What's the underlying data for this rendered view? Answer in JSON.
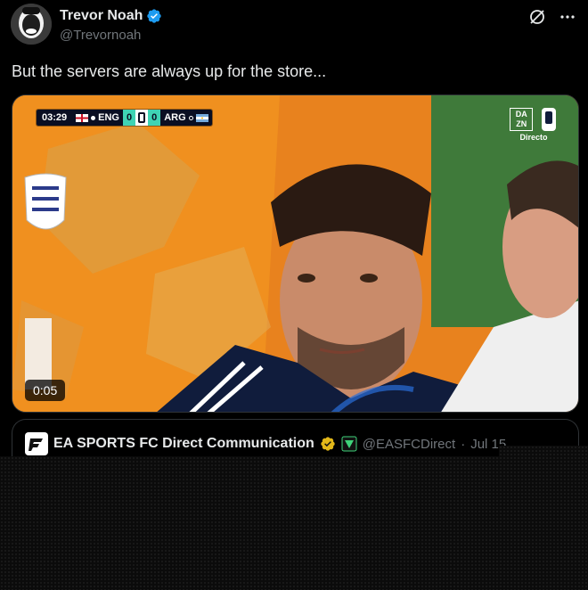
{
  "tweet": {
    "author": {
      "display_name": "Trevor Noah",
      "handle": "@Trevornoah",
      "verified_badge_color": "#1d9bf0"
    },
    "text": "But the servers are always up for the store...",
    "icons": {
      "grok": "grok-icon",
      "more": "more-icon"
    }
  },
  "video": {
    "duration": "0:05",
    "scorebug": {
      "clock": "03:29",
      "home_team": "ENG",
      "home_score": "0",
      "away_score": "0",
      "away_team": "ARG"
    },
    "broadcaster": {
      "logo_text": "DA\nZN",
      "label": "Directo"
    }
  },
  "quoted_tweet": {
    "display_name": "EA SPORTS FC Direct Communication",
    "handle": "@EASFCDirect",
    "separator": "·",
    "date": "Jul 15",
    "badge_color": "#e2b719"
  },
  "colors": {
    "background": "#000000",
    "text_primary": "#e7e9ea",
    "text_secondary": "#71767b",
    "border": "#2f3336"
  }
}
